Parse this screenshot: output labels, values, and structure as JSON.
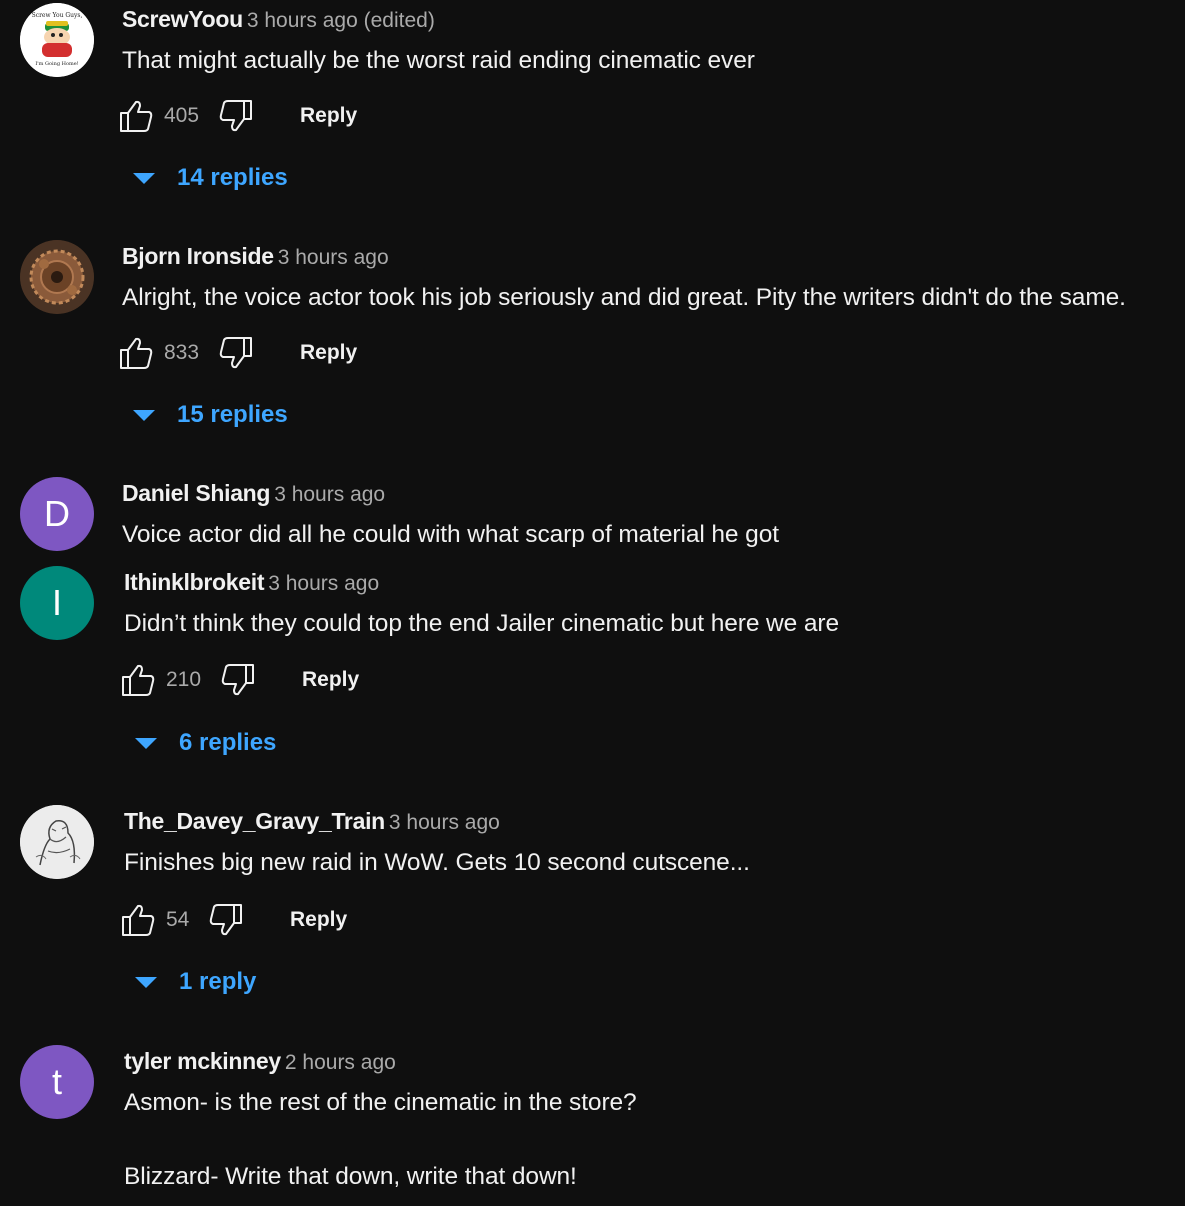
{
  "comments": [
    {
      "author": "ScrewYoou",
      "time": "3 hours ago (edited)",
      "text": "That might actually be the worst raid ending cinematic ever",
      "likes": "405",
      "reply_label": "Reply",
      "replies_label": "14 replies",
      "avatar": {
        "type": "image",
        "icon": "cartoon-character-avatar",
        "caption_top": "Screw You Guys,",
        "caption_bottom": "I'm Going Home!"
      }
    },
    {
      "author": "Bjorn Ironside",
      "time": "3 hours ago",
      "text": "Alright, the voice actor took his job seriously and did great. Pity the writers didn't do the same.",
      "likes": "833",
      "reply_label": "Reply",
      "replies_label": "15 replies",
      "avatar": {
        "type": "image",
        "icon": "bronze-gear-avatar"
      }
    },
    {
      "author": "Daniel Shiang",
      "time": "3 hours ago",
      "text": "Voice actor did all he could with what scarp of material he got",
      "avatar": {
        "type": "letter",
        "letter": "D",
        "color": "#7e57c2"
      }
    },
    {
      "author": "Ithinklbrokeit",
      "time": "3 hours ago",
      "text": "Didn’t think they could top the end Jailer cinematic but here we are",
      "likes": "210",
      "reply_label": "Reply",
      "replies_label": "6 replies",
      "avatar": {
        "type": "letter",
        "letter": "I",
        "color": "#00897b"
      }
    },
    {
      "author": "The_Davey_Gravy_Train",
      "time": "3 hours ago",
      "text": "Finishes big new raid in WoW. Gets 10 second cutscene...",
      "likes": "54",
      "reply_label": "Reply",
      "replies_label": "1 reply",
      "avatar": {
        "type": "image",
        "icon": "sketch-drawing-avatar"
      }
    },
    {
      "author": "tyler mckinney",
      "time": "2 hours ago",
      "text": "Asmon- is the rest of the cinematic in the store?",
      "text2": "Blizzard- Write that down, write that down!",
      "avatar": {
        "type": "letter",
        "letter": "t",
        "color": "#7e57c2"
      }
    }
  ],
  "colors": {
    "background": "#0f0f0f",
    "link_blue": "#3ea6ff",
    "secondary_text": "#aaaaaa"
  }
}
